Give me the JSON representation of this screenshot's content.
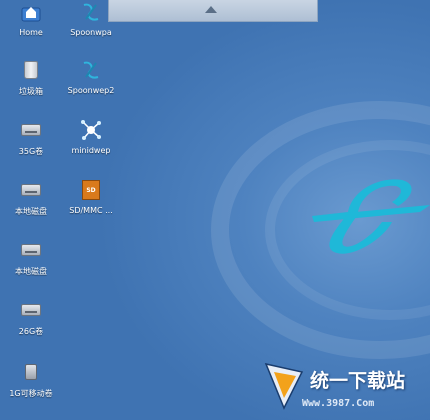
{
  "desktop": {
    "icons": [
      {
        "label": "Home",
        "icon": "home-folder-icon"
      },
      {
        "label": "Spoonwpa",
        "icon": "spoon-app-icon"
      },
      {
        "label": "垃圾箱",
        "icon": "trash-icon"
      },
      {
        "label": "Spoonwep2",
        "icon": "spoon-app-icon"
      },
      {
        "label": "35G卷",
        "icon": "drive-icon"
      },
      {
        "label": "minidwep",
        "icon": "network-app-icon"
      },
      {
        "label": "本地磁盘",
        "icon": "drive-icon"
      },
      {
        "label": "SD/MMC ...",
        "icon": "sd-card-icon"
      },
      {
        "label": "本地磁盘",
        "icon": "drive-icon"
      },
      {
        "label": "26G卷",
        "icon": "drive-icon"
      },
      {
        "label": "1G可移动卷",
        "icon": "usb-drive-icon"
      }
    ]
  },
  "watermark": {
    "text": "统一下载站",
    "url": "Www.3987.Com"
  },
  "colors": {
    "background": "#4f83c0",
    "logo": "#1fb8d8"
  }
}
